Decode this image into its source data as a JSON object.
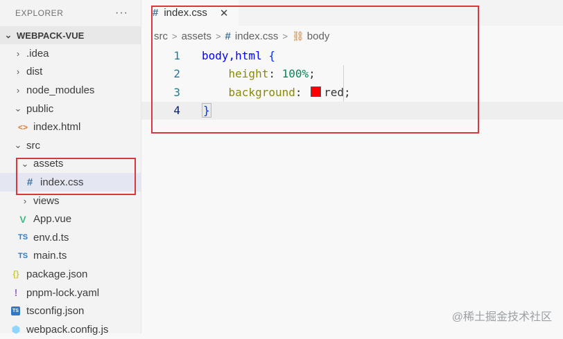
{
  "explorer": {
    "title": "EXPLORER",
    "more": "···",
    "project": "WEBPACK-VUE",
    "tree": [
      {
        "label": ".idea",
        "type": "folder",
        "expanded": false,
        "depth": 1
      },
      {
        "label": "dist",
        "type": "folder",
        "expanded": false,
        "depth": 1
      },
      {
        "label": "node_modules",
        "type": "folder",
        "expanded": false,
        "depth": 1
      },
      {
        "label": "public",
        "type": "folder",
        "expanded": true,
        "depth": 1
      },
      {
        "label": "index.html",
        "type": "html",
        "depth": 2
      },
      {
        "label": "src",
        "type": "folder",
        "expanded": true,
        "depth": 1
      },
      {
        "label": "assets",
        "type": "folder",
        "expanded": true,
        "depth": 2
      },
      {
        "label": "index.css",
        "type": "css",
        "depth": 3,
        "selected": true
      },
      {
        "label": "views",
        "type": "folder",
        "expanded": false,
        "depth": 2
      },
      {
        "label": "App.vue",
        "type": "vue",
        "depth": 2
      },
      {
        "label": "env.d.ts",
        "type": "ts",
        "depth": 2
      },
      {
        "label": "main.ts",
        "type": "ts",
        "depth": 2
      },
      {
        "label": "package.json",
        "type": "json",
        "depth": 1
      },
      {
        "label": "pnpm-lock.yaml",
        "type": "yaml",
        "depth": 1
      },
      {
        "label": "tsconfig.json",
        "type": "tsconfig",
        "depth": 1
      },
      {
        "label": "webpack.config.js",
        "type": "webpack",
        "depth": 1
      }
    ]
  },
  "icons": {
    "chevron_right": "›",
    "chevron_down": "⌄",
    "css": "#",
    "html": "<>",
    "vue": "V",
    "ts": "TS",
    "json": "{}",
    "yaml": "!",
    "tsconfig": "TS",
    "webpack": "⬢",
    "close": "✕",
    "symbol": "⛓"
  },
  "editor": {
    "tab": {
      "label": "index.css",
      "icon": "#",
      "close": "✕"
    },
    "breadcrumb": {
      "src": "src",
      "assets": "assets",
      "file": "index.css",
      "symbol": "body",
      "sep": ">"
    },
    "lines": [
      {
        "n": "1",
        "selector": "body,html",
        "brace": "{"
      },
      {
        "n": "2",
        "prop": "height",
        "colon": ":",
        "value": "100%",
        "semi": ";"
      },
      {
        "n": "3",
        "prop": "background",
        "colon": ":",
        "value": "red",
        "semi": ";",
        "swatch": "#ff0000"
      },
      {
        "n": "4",
        "brace": "}"
      }
    ]
  },
  "colors": {
    "highlight": "#d9363e",
    "swatch": "#ff0000"
  },
  "watermark": "@稀土掘金技术社区"
}
